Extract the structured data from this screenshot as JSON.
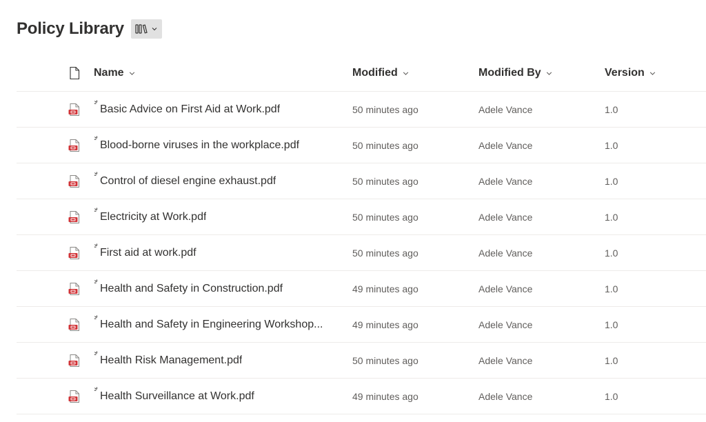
{
  "library": {
    "title": "Policy Library"
  },
  "columns": {
    "name": "Name",
    "modified": "Modified",
    "modified_by": "Modified By",
    "version": "Version"
  },
  "colors": {
    "pdf_icon": "#d13438",
    "text": "#323130",
    "secondary_text": "#605e5c",
    "divider": "#edebe9"
  },
  "rows": [
    {
      "name": "Basic Advice on First Aid at Work.pdf",
      "modified": "50 minutes ago",
      "modified_by": "Adele Vance",
      "version": "1.0"
    },
    {
      "name": "Blood-borne viruses in the workplace.pdf",
      "modified": "50 minutes ago",
      "modified_by": "Adele Vance",
      "version": "1.0"
    },
    {
      "name": "Control of diesel engine exhaust.pdf",
      "modified": "50 minutes ago",
      "modified_by": "Adele Vance",
      "version": "1.0"
    },
    {
      "name": "Electricity at Work.pdf",
      "modified": "50 minutes ago",
      "modified_by": "Adele Vance",
      "version": "1.0"
    },
    {
      "name": "First aid at work.pdf",
      "modified": "50 minutes ago",
      "modified_by": "Adele Vance",
      "version": "1.0"
    },
    {
      "name": "Health and Safety in Construction.pdf",
      "modified": "49 minutes ago",
      "modified_by": "Adele Vance",
      "version": "1.0"
    },
    {
      "name": "Health and Safety in Engineering Workshop...",
      "modified": "49 minutes ago",
      "modified_by": "Adele Vance",
      "version": "1.0"
    },
    {
      "name": "Health Risk Management.pdf",
      "modified": "50 minutes ago",
      "modified_by": "Adele Vance",
      "version": "1.0"
    },
    {
      "name": "Health Surveillance at Work.pdf",
      "modified": "49 minutes ago",
      "modified_by": "Adele Vance",
      "version": "1.0"
    }
  ]
}
